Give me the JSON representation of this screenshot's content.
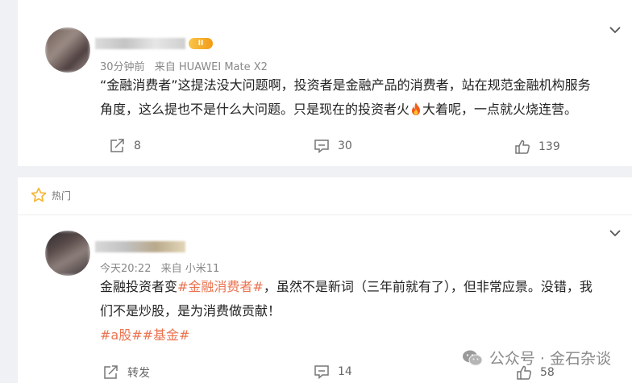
{
  "comments": [
    {
      "meta_time": "30分钟前",
      "meta_source": "来自 HUAWEI Mate X2",
      "badge": "II",
      "text_pre": "“金融消费者”这提法没大问题啊，投资者是金融产品的消费者，站在规范金融机构服务",
      "text_line2_pre": "角度，这么提也不是什么大问题。只是现在的投资者火",
      "text_line2_post": "大着呢，一点就火烧连营。",
      "emoji": "fire-emoji",
      "share_count": "8",
      "comment_count": "30",
      "like_count": "139"
    },
    {
      "hot_label": "热门",
      "meta_time": "今天20:22",
      "meta_source": "来自 小米11",
      "text_pre": "金融投资者变",
      "text_tag": "#金融消费者#",
      "text_post": "，虽然不是新词（三年前就有了），但非常应景。没错，我",
      "text_line2": "们不是炒股，是为消费做贡献！",
      "tags_line": "#a股##基金#",
      "share_label": "转发",
      "comment_count": "14",
      "like_count": "58"
    }
  ],
  "watermark": {
    "text": "公众号 · 金石杂谈",
    "icon": "wechat-icon"
  },
  "colors": {
    "accent": "#eb7350",
    "hot_star": "#f6b431",
    "badge": "#f7a81b"
  }
}
